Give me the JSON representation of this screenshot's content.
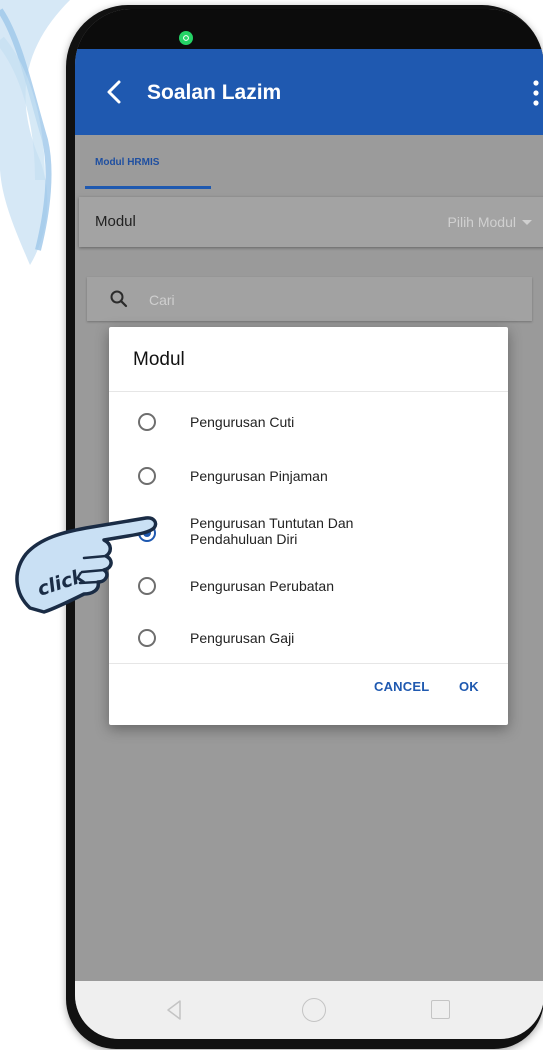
{
  "app_bar": {
    "title": "Soalan Lazim"
  },
  "tabs": [
    {
      "label": "Modul HRMIS",
      "active": true
    }
  ],
  "module_filter": {
    "label": "Modul",
    "value": "Pilih Modul"
  },
  "search": {
    "placeholder": "Cari"
  },
  "dialog": {
    "title": "Modul",
    "options": [
      {
        "label": "Pengurusan Cuti",
        "selected": false
      },
      {
        "label": "Pengurusan Pinjaman",
        "selected": false
      },
      {
        "label": "Pengurusan Tuntutan Dan Pendahuluan Diri",
        "selected": true
      },
      {
        "label": "Pengurusan Perubatan",
        "selected": false
      },
      {
        "label": "Pengurusan Gaji",
        "selected": false
      }
    ],
    "cancel_label": "CANCEL",
    "ok_label": "OK"
  },
  "annotation": {
    "text": "click"
  },
  "icons": {
    "status": "whatsapp-icon",
    "back": "chevron-left-icon",
    "menu": "more-vertical-icon",
    "search": "search-icon",
    "nav": [
      "nav-back-icon",
      "nav-home-icon",
      "nav-recent-icon"
    ]
  },
  "colors": {
    "primary": "#1f59b0",
    "scrim": "#9a9a9a",
    "dialog_bg": "#ffffff",
    "notification": "#25d366"
  }
}
